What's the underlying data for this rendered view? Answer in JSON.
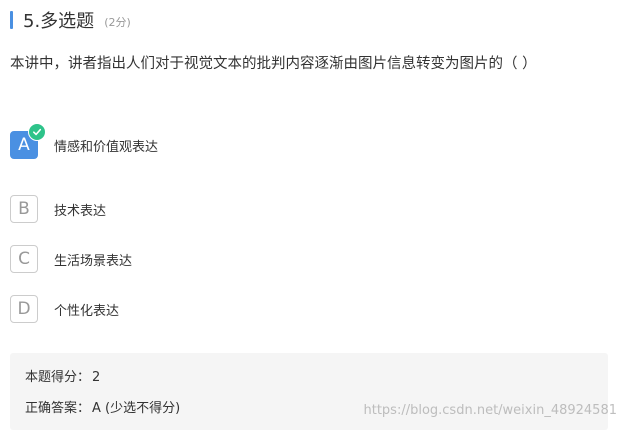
{
  "question": {
    "title": "5.多选题",
    "score": "(2分)",
    "text": "本讲中，讲者指出人们对于视觉文本的批判内容逐渐由图片信息转变为图片的（    ）"
  },
  "options": [
    {
      "letter": "A",
      "label": "情感和价值观表达",
      "selected": true
    },
    {
      "letter": "B",
      "label": "技术表达",
      "selected": false
    },
    {
      "letter": "C",
      "label": "生活场景表达",
      "selected": false
    },
    {
      "letter": "D",
      "label": "个性化表达",
      "selected": false
    }
  ],
  "result": {
    "score_label": "本题得分：",
    "score_value": "2",
    "answer_label": "正确答案：",
    "answer_value": "A (少选不得分)"
  },
  "watermark": "https://blog.csdn.net/weixin_48924581",
  "colors": {
    "accent": "#4a90e2",
    "check": "#2ec38a",
    "panel_bg": "#f5f5f5"
  },
  "icons": {
    "check": "check-icon"
  }
}
